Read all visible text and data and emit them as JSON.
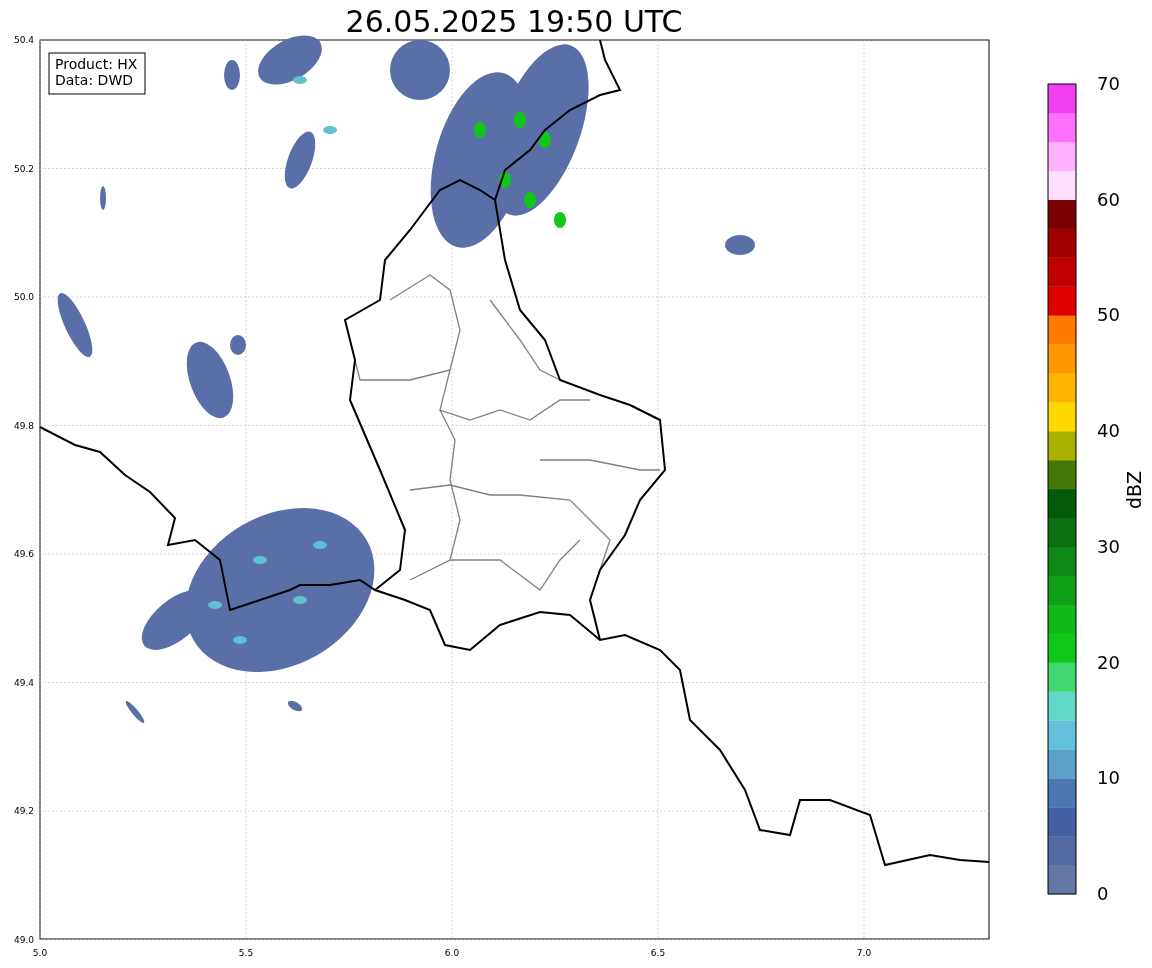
{
  "title": "26.05.2025 19:50 UTC",
  "info_box": [
    "Product: HX",
    "Data: DWD"
  ],
  "x_ticks": [
    "5.0",
    "5.5",
    "6.0",
    "6.5",
    "7.0"
  ],
  "y_ticks": [
    "50.4",
    "50.2",
    "50.0",
    "49.8",
    "49.6",
    "49.4",
    "49.2",
    "49.0"
  ],
  "colorbar": {
    "label": "dBZ",
    "ticks": [
      "70",
      "60",
      "50",
      "40",
      "30",
      "20",
      "10",
      "0"
    ],
    "segments": [
      {
        "color": "#6478a8"
      },
      {
        "color": "#5468a4"
      },
      {
        "color": "#4460a4"
      },
      {
        "color": "#4a78b0"
      },
      {
        "color": "#5aa0c8"
      },
      {
        "color": "#64c0dc"
      },
      {
        "color": "#60d8c8"
      },
      {
        "color": "#40d870"
      },
      {
        "color": "#10c818"
      },
      {
        "color": "#10b818"
      },
      {
        "color": "#10a018"
      },
      {
        "color": "#108818"
      },
      {
        "color": "#0a7010"
      },
      {
        "color": "#045a08"
      },
      {
        "color": "#467808"
      },
      {
        "color": "#a8b000"
      },
      {
        "color": "#ffd800"
      },
      {
        "color": "#ffb400"
      },
      {
        "color": "#ff9800"
      },
      {
        "color": "#ff7800"
      },
      {
        "color": "#e00000"
      },
      {
        "color": "#c00000"
      },
      {
        "color": "#a00000"
      },
      {
        "color": "#780000"
      },
      {
        "color": "#ffe0ff"
      },
      {
        "color": "#ffb0ff"
      },
      {
        "color": "#ff70ff"
      },
      {
        "color": "#f040f0"
      }
    ]
  }
}
